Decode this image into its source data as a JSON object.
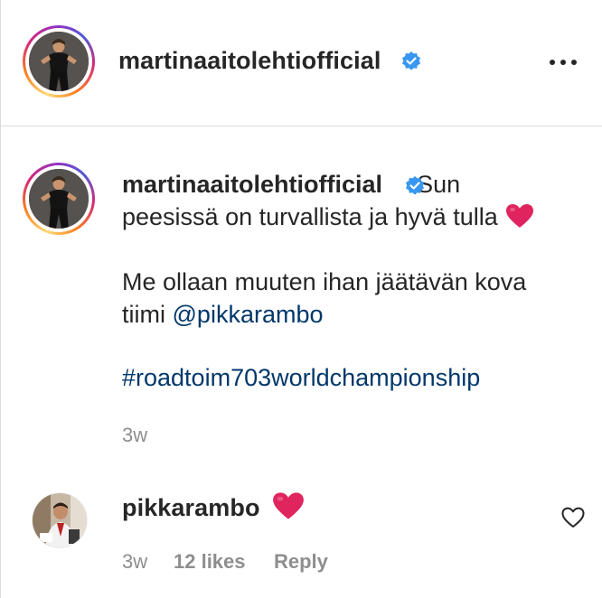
{
  "post": {
    "username": "martinaaitolehtiofficial",
    "more_icon": "more-horizontal-icon"
  },
  "caption": {
    "username": "martinaaitolehtiofficial",
    "line1_text": "Sun",
    "line2_text": "peesissä on turvallista ja hyvä tulla",
    "line2_emoji": "red-heart-emoji",
    "line3_text": "Me ollaan muuten ihan jäätävän kova",
    "line4_text": "tiimi",
    "mention": "@pikkarambo",
    "hashtag": "#roadtoim703worldchampionship",
    "time": "3w"
  },
  "comment": {
    "username": "pikkarambo",
    "emoji": "red-heart-emoji",
    "time": "3w",
    "likes": "12 likes",
    "reply_label": "Reply",
    "like_icon": "heart-outline-icon"
  },
  "colors": {
    "text": "#262626",
    "secondary": "#8e8e8e",
    "link": "#00376b",
    "verified": "#3897f0",
    "heart": "#e0245e",
    "divider": "#dbdbdb"
  }
}
